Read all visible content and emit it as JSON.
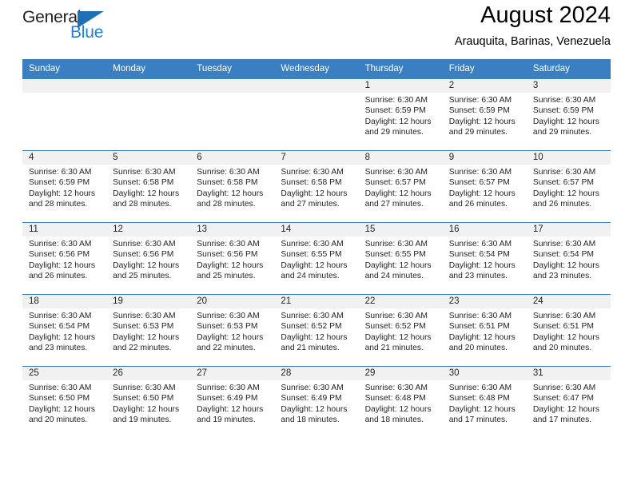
{
  "logo": {
    "word1": "General",
    "word2": "Blue",
    "triangle_color": "#1f6fb5",
    "word2_color": "#1f7fd4",
    "icon": "general-blue-logo"
  },
  "header": {
    "title": "August 2024",
    "subtitle": "Arauquita, Barinas, Venezuela"
  },
  "theme": {
    "header_blue": "#3a7fc1",
    "band_gray": "#f1f1f1",
    "text": "#231f20"
  },
  "calendar": {
    "weekday_headers": [
      "Sunday",
      "Monday",
      "Tuesday",
      "Wednesday",
      "Thursday",
      "Friday",
      "Saturday"
    ],
    "weeks": [
      [
        {
          "day": "",
          "sunrise": "",
          "sunset": "",
          "daylight_line1": "",
          "daylight_line2": ""
        },
        {
          "day": "",
          "sunrise": "",
          "sunset": "",
          "daylight_line1": "",
          "daylight_line2": ""
        },
        {
          "day": "",
          "sunrise": "",
          "sunset": "",
          "daylight_line1": "",
          "daylight_line2": ""
        },
        {
          "day": "",
          "sunrise": "",
          "sunset": "",
          "daylight_line1": "",
          "daylight_line2": ""
        },
        {
          "day": "1",
          "sunrise": "Sunrise: 6:30 AM",
          "sunset": "Sunset: 6:59 PM",
          "daylight_line1": "Daylight: 12 hours",
          "daylight_line2": "and 29 minutes."
        },
        {
          "day": "2",
          "sunrise": "Sunrise: 6:30 AM",
          "sunset": "Sunset: 6:59 PM",
          "daylight_line1": "Daylight: 12 hours",
          "daylight_line2": "and 29 minutes."
        },
        {
          "day": "3",
          "sunrise": "Sunrise: 6:30 AM",
          "sunset": "Sunset: 6:59 PM",
          "daylight_line1": "Daylight: 12 hours",
          "daylight_line2": "and 29 minutes."
        }
      ],
      [
        {
          "day": "4",
          "sunrise": "Sunrise: 6:30 AM",
          "sunset": "Sunset: 6:59 PM",
          "daylight_line1": "Daylight: 12 hours",
          "daylight_line2": "and 28 minutes."
        },
        {
          "day": "5",
          "sunrise": "Sunrise: 6:30 AM",
          "sunset": "Sunset: 6:58 PM",
          "daylight_line1": "Daylight: 12 hours",
          "daylight_line2": "and 28 minutes."
        },
        {
          "day": "6",
          "sunrise": "Sunrise: 6:30 AM",
          "sunset": "Sunset: 6:58 PM",
          "daylight_line1": "Daylight: 12 hours",
          "daylight_line2": "and 28 minutes."
        },
        {
          "day": "7",
          "sunrise": "Sunrise: 6:30 AM",
          "sunset": "Sunset: 6:58 PM",
          "daylight_line1": "Daylight: 12 hours",
          "daylight_line2": "and 27 minutes."
        },
        {
          "day": "8",
          "sunrise": "Sunrise: 6:30 AM",
          "sunset": "Sunset: 6:57 PM",
          "daylight_line1": "Daylight: 12 hours",
          "daylight_line2": "and 27 minutes."
        },
        {
          "day": "9",
          "sunrise": "Sunrise: 6:30 AM",
          "sunset": "Sunset: 6:57 PM",
          "daylight_line1": "Daylight: 12 hours",
          "daylight_line2": "and 26 minutes."
        },
        {
          "day": "10",
          "sunrise": "Sunrise: 6:30 AM",
          "sunset": "Sunset: 6:57 PM",
          "daylight_line1": "Daylight: 12 hours",
          "daylight_line2": "and 26 minutes."
        }
      ],
      [
        {
          "day": "11",
          "sunrise": "Sunrise: 6:30 AM",
          "sunset": "Sunset: 6:56 PM",
          "daylight_line1": "Daylight: 12 hours",
          "daylight_line2": "and 26 minutes."
        },
        {
          "day": "12",
          "sunrise": "Sunrise: 6:30 AM",
          "sunset": "Sunset: 6:56 PM",
          "daylight_line1": "Daylight: 12 hours",
          "daylight_line2": "and 25 minutes."
        },
        {
          "day": "13",
          "sunrise": "Sunrise: 6:30 AM",
          "sunset": "Sunset: 6:56 PM",
          "daylight_line1": "Daylight: 12 hours",
          "daylight_line2": "and 25 minutes."
        },
        {
          "day": "14",
          "sunrise": "Sunrise: 6:30 AM",
          "sunset": "Sunset: 6:55 PM",
          "daylight_line1": "Daylight: 12 hours",
          "daylight_line2": "and 24 minutes."
        },
        {
          "day": "15",
          "sunrise": "Sunrise: 6:30 AM",
          "sunset": "Sunset: 6:55 PM",
          "daylight_line1": "Daylight: 12 hours",
          "daylight_line2": "and 24 minutes."
        },
        {
          "day": "16",
          "sunrise": "Sunrise: 6:30 AM",
          "sunset": "Sunset: 6:54 PM",
          "daylight_line1": "Daylight: 12 hours",
          "daylight_line2": "and 23 minutes."
        },
        {
          "day": "17",
          "sunrise": "Sunrise: 6:30 AM",
          "sunset": "Sunset: 6:54 PM",
          "daylight_line1": "Daylight: 12 hours",
          "daylight_line2": "and 23 minutes."
        }
      ],
      [
        {
          "day": "18",
          "sunrise": "Sunrise: 6:30 AM",
          "sunset": "Sunset: 6:54 PM",
          "daylight_line1": "Daylight: 12 hours",
          "daylight_line2": "and 23 minutes."
        },
        {
          "day": "19",
          "sunrise": "Sunrise: 6:30 AM",
          "sunset": "Sunset: 6:53 PM",
          "daylight_line1": "Daylight: 12 hours",
          "daylight_line2": "and 22 minutes."
        },
        {
          "day": "20",
          "sunrise": "Sunrise: 6:30 AM",
          "sunset": "Sunset: 6:53 PM",
          "daylight_line1": "Daylight: 12 hours",
          "daylight_line2": "and 22 minutes."
        },
        {
          "day": "21",
          "sunrise": "Sunrise: 6:30 AM",
          "sunset": "Sunset: 6:52 PM",
          "daylight_line1": "Daylight: 12 hours",
          "daylight_line2": "and 21 minutes."
        },
        {
          "day": "22",
          "sunrise": "Sunrise: 6:30 AM",
          "sunset": "Sunset: 6:52 PM",
          "daylight_line1": "Daylight: 12 hours",
          "daylight_line2": "and 21 minutes."
        },
        {
          "day": "23",
          "sunrise": "Sunrise: 6:30 AM",
          "sunset": "Sunset: 6:51 PM",
          "daylight_line1": "Daylight: 12 hours",
          "daylight_line2": "and 20 minutes."
        },
        {
          "day": "24",
          "sunrise": "Sunrise: 6:30 AM",
          "sunset": "Sunset: 6:51 PM",
          "daylight_line1": "Daylight: 12 hours",
          "daylight_line2": "and 20 minutes."
        }
      ],
      [
        {
          "day": "25",
          "sunrise": "Sunrise: 6:30 AM",
          "sunset": "Sunset: 6:50 PM",
          "daylight_line1": "Daylight: 12 hours",
          "daylight_line2": "and 20 minutes."
        },
        {
          "day": "26",
          "sunrise": "Sunrise: 6:30 AM",
          "sunset": "Sunset: 6:50 PM",
          "daylight_line1": "Daylight: 12 hours",
          "daylight_line2": "and 19 minutes."
        },
        {
          "day": "27",
          "sunrise": "Sunrise: 6:30 AM",
          "sunset": "Sunset: 6:49 PM",
          "daylight_line1": "Daylight: 12 hours",
          "daylight_line2": "and 19 minutes."
        },
        {
          "day": "28",
          "sunrise": "Sunrise: 6:30 AM",
          "sunset": "Sunset: 6:49 PM",
          "daylight_line1": "Daylight: 12 hours",
          "daylight_line2": "and 18 minutes."
        },
        {
          "day": "29",
          "sunrise": "Sunrise: 6:30 AM",
          "sunset": "Sunset: 6:48 PM",
          "daylight_line1": "Daylight: 12 hours",
          "daylight_line2": "and 18 minutes."
        },
        {
          "day": "30",
          "sunrise": "Sunrise: 6:30 AM",
          "sunset": "Sunset: 6:48 PM",
          "daylight_line1": "Daylight: 12 hours",
          "daylight_line2": "and 17 minutes."
        },
        {
          "day": "31",
          "sunrise": "Sunrise: 6:30 AM",
          "sunset": "Sunset: 6:47 PM",
          "daylight_line1": "Daylight: 12 hours",
          "daylight_line2": "and 17 minutes."
        }
      ]
    ]
  }
}
